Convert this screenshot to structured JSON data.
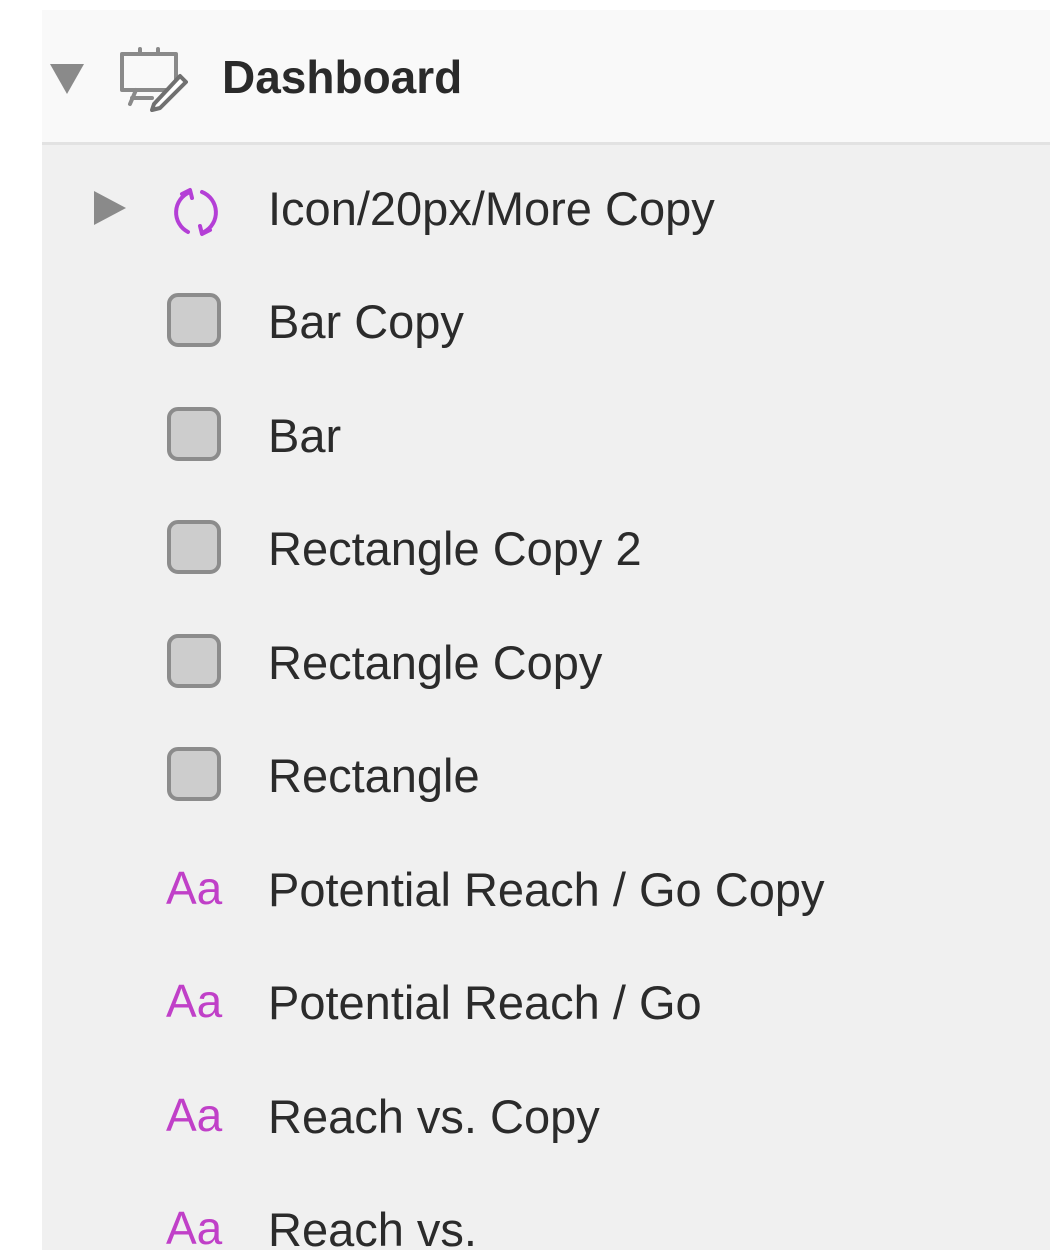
{
  "artboard": {
    "title": "Dashboard",
    "icon": "artboard-icon",
    "expanded": true
  },
  "layers": [
    {
      "type": "symbol",
      "label": "Icon/20px/More Copy",
      "icon": "symbol-icon",
      "collapsed": true
    },
    {
      "type": "shape",
      "label": "Bar Copy",
      "icon": "shape-icon"
    },
    {
      "type": "shape",
      "label": "Bar",
      "icon": "shape-icon"
    },
    {
      "type": "shape",
      "label": "Rectangle Copy 2",
      "icon": "shape-icon"
    },
    {
      "type": "shape",
      "label": "Rectangle Copy",
      "icon": "shape-icon"
    },
    {
      "type": "shape",
      "label": "Rectangle",
      "icon": "shape-icon"
    },
    {
      "type": "text",
      "label": "Potential Reach / Go Copy",
      "icon": "text-icon",
      "glyph": "Aa"
    },
    {
      "type": "text",
      "label": "Potential Reach / Go",
      "icon": "text-icon",
      "glyph": "Aa"
    },
    {
      "type": "text",
      "label": "Reach vs. Copy",
      "icon": "text-icon",
      "glyph": "Aa"
    },
    {
      "type": "text",
      "label": "Reach vs.",
      "icon": "text-icon",
      "glyph": "Aa"
    }
  ],
  "colors": {
    "symbol_accent": "#b43fd6",
    "text_accent": "#c040c8",
    "shape_fill": "#cdcdcd",
    "shape_border": "#8c8c8c",
    "list_background": "#f0f0f0",
    "header_background": "#f9f9f9"
  }
}
